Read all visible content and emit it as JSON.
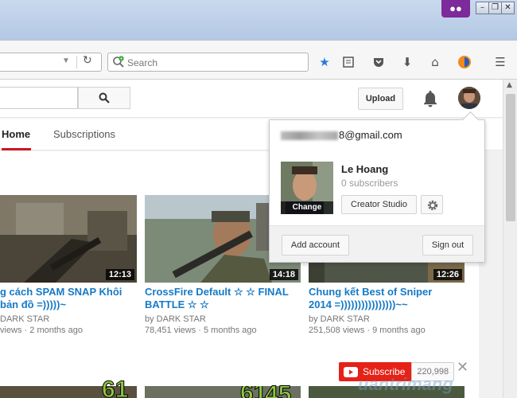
{
  "browser": {
    "search_placeholder": "Search",
    "accent": "#7d2a9b"
  },
  "header": {
    "upload_label": "Upload"
  },
  "tabs": [
    {
      "label": "Home",
      "active": true
    },
    {
      "label": "Subscriptions",
      "active": false
    }
  ],
  "videos": [
    {
      "title_line1": "g cách SPAM SNAP Khôi",
      "title_line2": "bản đồ =)))))~",
      "channel": "DARK STAR",
      "views": "views",
      "age": "2 months ago",
      "duration": "12:13"
    },
    {
      "title_line1": "CrossFire Default ☆ ☆ FINAL",
      "title_line2": "BATTLE ☆ ☆",
      "channel": "by DARK STAR",
      "views": "78,451 views",
      "age": "5 months ago",
      "duration": "14:18"
    },
    {
      "title_line1": "Chung kết Best of Sniper",
      "title_line2": "2014 =))))))))))))))))~~",
      "channel": "by DARK STAR",
      "views": "251,508 views",
      "age": "9 months ago",
      "duration": "12:26"
    }
  ],
  "subscribe": {
    "label": "Subscribe",
    "count": "220,998"
  },
  "account_popup": {
    "email_suffix": "8@gmail.com",
    "name": "Le Hoang",
    "subscribers": "0 subscribers",
    "change_label": "Change",
    "creator_studio_label": "Creator Studio",
    "add_account_label": "Add account",
    "sign_out_label": "Sign out"
  },
  "bottom_numbers": [
    "61",
    "45"
  ],
  "watermark": "uantrimang"
}
